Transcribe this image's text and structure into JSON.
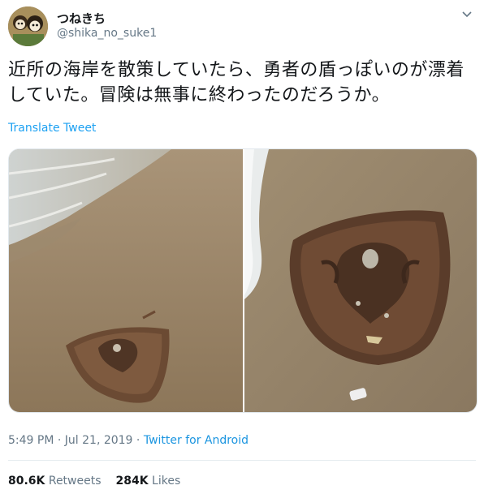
{
  "user": {
    "display_name": "つねきち",
    "handle": "@shika_no_suke1"
  },
  "tweet": {
    "line1": "近所の海岸を散策していたら、勇者の盾っぽいのが漂着",
    "line2": "していた。冒険は無事に終わったのだろうか。",
    "translate_label": "Translate Tweet"
  },
  "meta": {
    "time": "5:49 PM",
    "separator1": " · ",
    "date": "Jul 21, 2019",
    "separator2": " · ",
    "source": "Twitter for Android"
  },
  "stats": {
    "retweets_count": "80.6K",
    "retweets_label": "Retweets",
    "likes_count": "284K",
    "likes_label": "Likes"
  },
  "colors": {
    "link": "#1da1f2",
    "secondary_text": "#657786",
    "primary_text": "#14171a"
  }
}
